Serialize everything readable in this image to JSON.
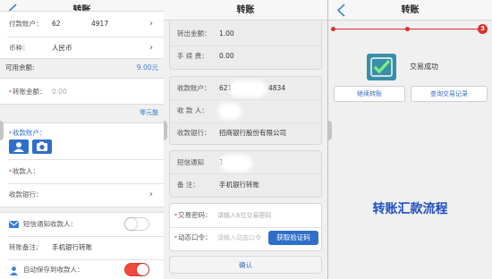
{
  "screen1": {
    "title": "转账",
    "pay_account_label": "付款账户：",
    "pay_account_value": "62",
    "pay_account_tail": "4917",
    "currency_label": "币种：",
    "currency_value": "人民币",
    "available_label": "可用余额:",
    "available_value": "9.00元",
    "amount_label": "转账金额：",
    "amount_placeholder": "0.00",
    "cents_link": "零元整",
    "payee_account_label": "收款账户：",
    "payee_label": "收款人：",
    "payee_bank_label": "收款银行：",
    "sms_label": "短信通知收款人：",
    "memo_label": "转账备注：",
    "memo_value": "手机银行转账",
    "autosave_label": "自动保存到收款人："
  },
  "screen2": {
    "title": "转账",
    "out_amount_label": "转出金额：",
    "out_amount_value": "1.00",
    "fee_label": "手 续 费：",
    "fee_value": "0.00",
    "payee_account_label": "收款账户：",
    "payee_account_value": "621",
    "payee_account_tail": "4834",
    "payee_label": "收 款 人：",
    "payee_bank_label": "收款银行：",
    "payee_bank_value": "招商银行股份有限公司",
    "sms_label": "短信通知",
    "sms_value": "1",
    "memo_label": "备 注：",
    "memo_value": "手机银行转账",
    "password_label": "交易密码：",
    "password_placeholder": "请输入6位交易密码",
    "otp_label": "动态口令：",
    "otp_placeholder": "请输入动态口令",
    "get_code_button": "获取验证码",
    "confirm_button": "确认"
  },
  "screen3": {
    "title": "转账",
    "step_number": "3",
    "success_text": "交易成功",
    "continue_button": "继续转账",
    "query_button": "查询交易记录",
    "caption": "转账汇款流程"
  },
  "colors": {
    "accent_blue": "#2f6fca",
    "success_teal": "#3a8fa8",
    "step_red": "#d9302b",
    "toggle_on": "#f04a3c",
    "caption_blue": "#1f4fbf"
  },
  "icons": [
    "back-chevron-icon",
    "chevron-right-icon",
    "contact-icon",
    "camera-icon",
    "mail-icon",
    "person-icon",
    "success-check-icon"
  ]
}
